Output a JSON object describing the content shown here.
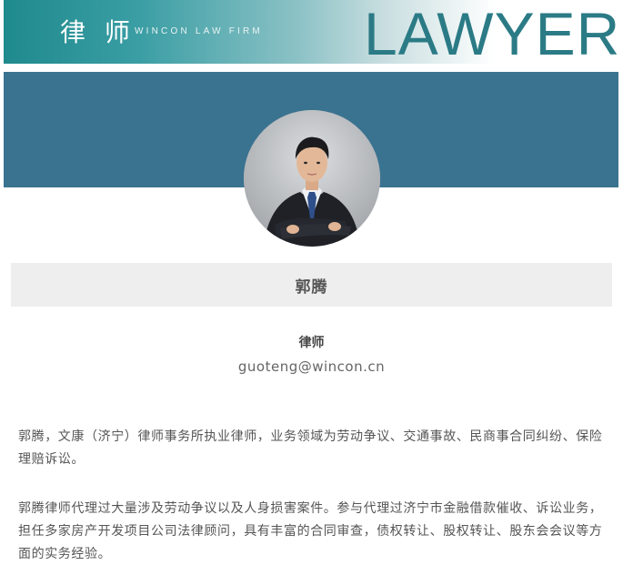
{
  "banner": {
    "cn_title": "律 师",
    "en_subtitle": "WINCON LAW FIRM",
    "big_word": "LAWYER"
  },
  "profile": {
    "avatar_alt": "郭腾",
    "name": "郭腾",
    "role": "律师",
    "email": "guoteng@wincon.cn"
  },
  "bio": {
    "paragraph_1": "郭腾，文康（济宁）律师事务所执业律师，业务领域为劳动争议、交通事故、民商事合同纠纷、保险理赔诉讼。",
    "paragraph_2": "郭腾律师代理过大量涉及劳动争议以及人身损害案件。参与代理过济宁市金融借款催收、诉讼业务，担任多家房产开发项目公司法律顾问，具有丰富的合同审查，债权转让、股权转让、股东会会议等方面的实务经验。"
  },
  "colors": {
    "banner_teal": "#1f8a8e",
    "header_block": "#3a7390",
    "name_bar": "#eeeeee",
    "text": "#555555"
  }
}
